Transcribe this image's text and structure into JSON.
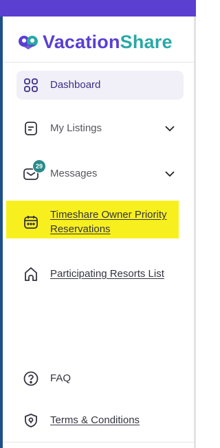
{
  "brand": {
    "name_part1": "Vacation",
    "name_part2": "Share"
  },
  "nav": {
    "dashboard": {
      "label": "Dashboard",
      "icon": "grid-icon"
    },
    "listings": {
      "label": "My Listings",
      "icon": "listing-icon"
    },
    "messages": {
      "label": "Messages",
      "icon": "mail-icon",
      "badge": "29"
    },
    "priority": {
      "label_line1": "Timeshare Owner Priority",
      "label_line2": "Reservations",
      "icon": "calendar-icon"
    },
    "resorts": {
      "label": "Participating Resorts List",
      "icon": "home-icon"
    },
    "faq": {
      "label": "FAQ",
      "icon": "help-circle-icon"
    },
    "terms": {
      "label": "Terms & Conditions",
      "icon": "shield-icon"
    }
  },
  "colors": {
    "accent": "#5a3fd1",
    "teal": "#2aa8a7",
    "highlight": "#f8f01e",
    "active_bg": "#f1eff7"
  }
}
